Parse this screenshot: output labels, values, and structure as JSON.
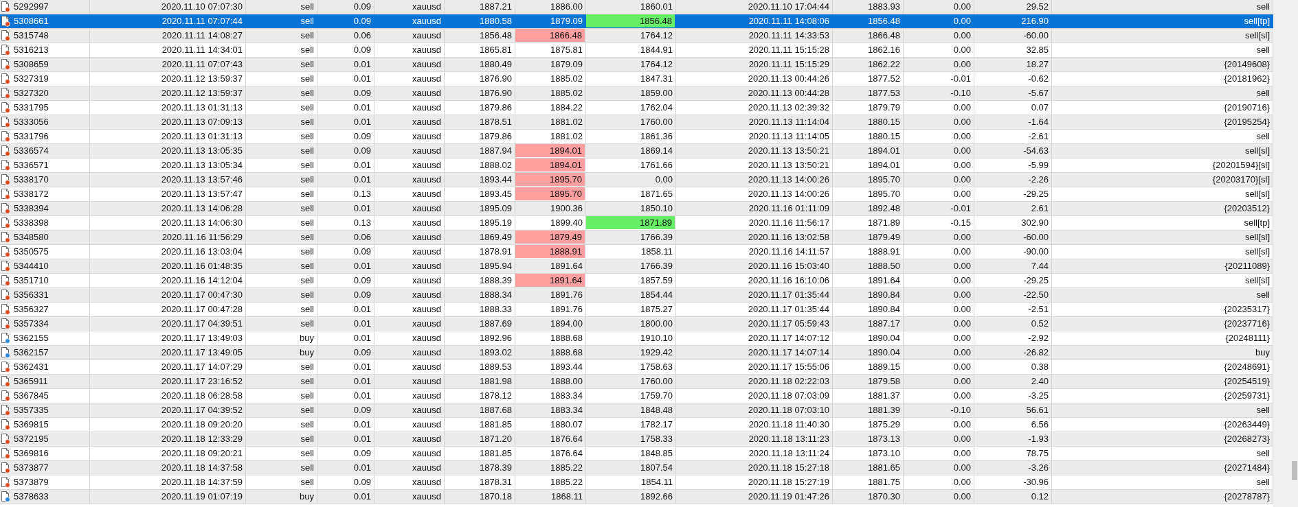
{
  "table": {
    "rows": [
      {
        "kind": "sell",
        "selected": false,
        "column_7_marked": false,
        "column_8_marked": false,
        "cells": [
          "5292997",
          "2020.11.10 07:07:30",
          "sell",
          "0.09",
          "xauusd",
          "1887.21",
          "1886.00",
          "1860.01",
          "2020.11.10 17:04:44",
          "1883.93",
          "0.00",
          "29.52",
          "sell"
        ]
      },
      {
        "kind": "sell",
        "selected": true,
        "column_7_marked": false,
        "column_8_marked": true,
        "cells": [
          "5308661",
          "2020.11.11 07:07:44",
          "sell",
          "0.09",
          "xauusd",
          "1880.58",
          "1879.09",
          "1856.48",
          "2020.11.11 14:08:06",
          "1856.48",
          "0.00",
          "216.90",
          "sell[tp]"
        ]
      },
      {
        "kind": "sell",
        "selected": false,
        "column_7_marked": true,
        "column_8_marked": false,
        "cells": [
          "5315748",
          "2020.11.11 14:08:27",
          "sell",
          "0.06",
          "xauusd",
          "1856.48",
          "1866.48",
          "1764.12",
          "2020.11.11 14:33:53",
          "1866.48",
          "0.00",
          "-60.00",
          "sell[sl]"
        ]
      },
      {
        "kind": "sell",
        "selected": false,
        "column_7_marked": false,
        "column_8_marked": false,
        "cells": [
          "5316213",
          "2020.11.11 14:34:01",
          "sell",
          "0.09",
          "xauusd",
          "1865.81",
          "1875.81",
          "1844.91",
          "2020.11.11 15:15:28",
          "1862.16",
          "0.00",
          "32.85",
          "sell"
        ]
      },
      {
        "kind": "sell",
        "selected": false,
        "column_7_marked": false,
        "column_8_marked": false,
        "cells": [
          "5308659",
          "2020.11.11 07:07:43",
          "sell",
          "0.01",
          "xauusd",
          "1880.49",
          "1879.09",
          "1764.12",
          "2020.11.11 15:15:29",
          "1862.22",
          "0.00",
          "18.27",
          "{20149608}"
        ]
      },
      {
        "kind": "sell",
        "selected": false,
        "column_7_marked": false,
        "column_8_marked": false,
        "cells": [
          "5327319",
          "2020.11.12 13:59:37",
          "sell",
          "0.01",
          "xauusd",
          "1876.90",
          "1885.02",
          "1847.31",
          "2020.11.13 00:44:26",
          "1877.52",
          "-0.01",
          "-0.62",
          "{20181962}"
        ]
      },
      {
        "kind": "sell",
        "selected": false,
        "column_7_marked": false,
        "column_8_marked": false,
        "cells": [
          "5327320",
          "2020.11.12 13:59:37",
          "sell",
          "0.09",
          "xauusd",
          "1876.90",
          "1885.02",
          "1859.00",
          "2020.11.13 00:44:28",
          "1877.53",
          "-0.10",
          "-5.67",
          "sell"
        ]
      },
      {
        "kind": "sell",
        "selected": false,
        "column_7_marked": false,
        "column_8_marked": false,
        "cells": [
          "5331795",
          "2020.11.13 01:31:13",
          "sell",
          "0.01",
          "xauusd",
          "1879.86",
          "1884.22",
          "1762.04",
          "2020.11.13 02:39:32",
          "1879.79",
          "0.00",
          "0.07",
          "{20190716}"
        ]
      },
      {
        "kind": "sell",
        "selected": false,
        "column_7_marked": false,
        "column_8_marked": false,
        "cells": [
          "5333056",
          "2020.11.13 07:09:13",
          "sell",
          "0.01",
          "xauusd",
          "1878.51",
          "1881.02",
          "1760.00",
          "2020.11.13 11:14:04",
          "1880.15",
          "0.00",
          "-1.64",
          "{20195254}"
        ]
      },
      {
        "kind": "sell",
        "selected": false,
        "column_7_marked": false,
        "column_8_marked": false,
        "cells": [
          "5331796",
          "2020.11.13 01:31:13",
          "sell",
          "0.09",
          "xauusd",
          "1879.86",
          "1881.02",
          "1861.36",
          "2020.11.13 11:14:05",
          "1880.15",
          "0.00",
          "-2.61",
          "sell"
        ]
      },
      {
        "kind": "sell",
        "selected": false,
        "column_7_marked": true,
        "column_8_marked": false,
        "cells": [
          "5336574",
          "2020.11.13 13:05:35",
          "sell",
          "0.09",
          "xauusd",
          "1887.94",
          "1894.01",
          "1869.14",
          "2020.11.13 13:50:21",
          "1894.01",
          "0.00",
          "-54.63",
          "sell[sl]"
        ]
      },
      {
        "kind": "sell",
        "selected": false,
        "column_7_marked": true,
        "column_8_marked": false,
        "cells": [
          "5336571",
          "2020.11.13 13:05:34",
          "sell",
          "0.01",
          "xauusd",
          "1888.02",
          "1894.01",
          "1761.66",
          "2020.11.13 13:50:21",
          "1894.01",
          "0.00",
          "-5.99",
          "{20201594}[sl]"
        ]
      },
      {
        "kind": "sell",
        "selected": false,
        "column_7_marked": true,
        "column_8_marked": false,
        "cells": [
          "5338170",
          "2020.11.13 13:57:46",
          "sell",
          "0.01",
          "xauusd",
          "1893.44",
          "1895.70",
          "0.00",
          "2020.11.13 14:00:26",
          "1895.70",
          "0.00",
          "-2.26",
          "{20203170}[sl]"
        ]
      },
      {
        "kind": "sell",
        "selected": false,
        "column_7_marked": true,
        "column_8_marked": false,
        "cells": [
          "5338172",
          "2020.11.13 13:57:47",
          "sell",
          "0.13",
          "xauusd",
          "1893.45",
          "1895.70",
          "1871.65",
          "2020.11.13 14:00:26",
          "1895.70",
          "0.00",
          "-29.25",
          "sell[sl]"
        ]
      },
      {
        "kind": "sell",
        "selected": false,
        "column_7_marked": false,
        "column_8_marked": false,
        "cells": [
          "5338394",
          "2020.11.13 14:06:28",
          "sell",
          "0.01",
          "xauusd",
          "1895.09",
          "1900.36",
          "1850.10",
          "2020.11.16 01:11:09",
          "1892.48",
          "-0.01",
          "2.61",
          "{20203512}"
        ]
      },
      {
        "kind": "sell",
        "selected": false,
        "column_7_marked": false,
        "column_8_marked": true,
        "cells": [
          "5338398",
          "2020.11.13 14:06:30",
          "sell",
          "0.13",
          "xauusd",
          "1895.19",
          "1899.40",
          "1871.89",
          "2020.11.16 11:56:17",
          "1871.89",
          "-0.15",
          "302.90",
          "sell[tp]"
        ]
      },
      {
        "kind": "sell",
        "selected": false,
        "column_7_marked": true,
        "column_8_marked": false,
        "cells": [
          "5348580",
          "2020.11.16 11:56:29",
          "sell",
          "0.06",
          "xauusd",
          "1869.49",
          "1879.49",
          "1766.39",
          "2020.11.16 13:02:58",
          "1879.49",
          "0.00",
          "-60.00",
          "sell[sl]"
        ]
      },
      {
        "kind": "sell",
        "selected": false,
        "column_7_marked": true,
        "column_8_marked": false,
        "cells": [
          "5350575",
          "2020.11.16 13:03:04",
          "sell",
          "0.09",
          "xauusd",
          "1878.91",
          "1888.91",
          "1858.11",
          "2020.11.16 14:11:57",
          "1888.91",
          "0.00",
          "-90.00",
          "sell[sl]"
        ]
      },
      {
        "kind": "sell",
        "selected": false,
        "column_7_marked": false,
        "column_8_marked": false,
        "cells": [
          "5344410",
          "2020.11.16 01:48:35",
          "sell",
          "0.01",
          "xauusd",
          "1895.94",
          "1891.64",
          "1766.39",
          "2020.11.16 15:03:40",
          "1888.50",
          "0.00",
          "7.44",
          "{20211089}"
        ]
      },
      {
        "kind": "sell",
        "selected": false,
        "column_7_marked": true,
        "column_8_marked": false,
        "cells": [
          "5351710",
          "2020.11.16 14:12:04",
          "sell",
          "0.09",
          "xauusd",
          "1888.39",
          "1891.64",
          "1857.59",
          "2020.11.16 16:10:06",
          "1891.64",
          "0.00",
          "-29.25",
          "sell[sl]"
        ]
      },
      {
        "kind": "sell",
        "selected": false,
        "column_7_marked": false,
        "column_8_marked": false,
        "cells": [
          "5356331",
          "2020.11.17 00:47:30",
          "sell",
          "0.09",
          "xauusd",
          "1888.34",
          "1891.76",
          "1854.44",
          "2020.11.17 01:35:44",
          "1890.84",
          "0.00",
          "-22.50",
          "sell"
        ]
      },
      {
        "kind": "sell",
        "selected": false,
        "column_7_marked": false,
        "column_8_marked": false,
        "cells": [
          "5356327",
          "2020.11.17 00:47:28",
          "sell",
          "0.01",
          "xauusd",
          "1888.33",
          "1891.76",
          "1875.27",
          "2020.11.17 01:35:44",
          "1890.84",
          "0.00",
          "-2.51",
          "{20235317}"
        ]
      },
      {
        "kind": "sell",
        "selected": false,
        "column_7_marked": false,
        "column_8_marked": false,
        "cells": [
          "5357334",
          "2020.11.17 04:39:51",
          "sell",
          "0.01",
          "xauusd",
          "1887.69",
          "1894.00",
          "1800.00",
          "2020.11.17 05:59:43",
          "1887.17",
          "0.00",
          "0.52",
          "{20237716}"
        ]
      },
      {
        "kind": "buy",
        "selected": false,
        "column_7_marked": false,
        "column_8_marked": false,
        "cells": [
          "5362155",
          "2020.11.17 13:49:03",
          "buy",
          "0.01",
          "xauusd",
          "1892.96",
          "1888.68",
          "1910.10",
          "2020.11.17 14:07:12",
          "1890.04",
          "0.00",
          "-2.92",
          "{20248111}"
        ]
      },
      {
        "kind": "buy",
        "selected": false,
        "column_7_marked": false,
        "column_8_marked": false,
        "cells": [
          "5362157",
          "2020.11.17 13:49:05",
          "buy",
          "0.09",
          "xauusd",
          "1893.02",
          "1888.68",
          "1929.42",
          "2020.11.17 14:07:14",
          "1890.04",
          "0.00",
          "-26.82",
          "buy"
        ]
      },
      {
        "kind": "sell",
        "selected": false,
        "column_7_marked": false,
        "column_8_marked": false,
        "cells": [
          "5362431",
          "2020.11.17 14:07:29",
          "sell",
          "0.01",
          "xauusd",
          "1889.53",
          "1893.44",
          "1758.63",
          "2020.11.17 15:55:06",
          "1889.15",
          "0.00",
          "0.38",
          "{20248691}"
        ]
      },
      {
        "kind": "sell",
        "selected": false,
        "column_7_marked": false,
        "column_8_marked": false,
        "cells": [
          "5365911",
          "2020.11.17 23:16:52",
          "sell",
          "0.01",
          "xauusd",
          "1881.98",
          "1888.00",
          "1760.00",
          "2020.11.18 02:22:03",
          "1879.58",
          "0.00",
          "2.40",
          "{20254519}"
        ]
      },
      {
        "kind": "sell",
        "selected": false,
        "column_7_marked": false,
        "column_8_marked": false,
        "cells": [
          "5367845",
          "2020.11.18 06:28:58",
          "sell",
          "0.01",
          "xauusd",
          "1878.12",
          "1883.34",
          "1759.70",
          "2020.11.18 07:03:09",
          "1881.37",
          "0.00",
          "-3.25",
          "{20259731}"
        ]
      },
      {
        "kind": "sell",
        "selected": false,
        "column_7_marked": false,
        "column_8_marked": false,
        "cells": [
          "5357335",
          "2020.11.17 04:39:52",
          "sell",
          "0.09",
          "xauusd",
          "1887.68",
          "1883.34",
          "1848.48",
          "2020.11.18 07:03:10",
          "1881.39",
          "-0.10",
          "56.61",
          "sell"
        ]
      },
      {
        "kind": "sell",
        "selected": false,
        "column_7_marked": false,
        "column_8_marked": false,
        "cells": [
          "5369815",
          "2020.11.18 09:20:20",
          "sell",
          "0.01",
          "xauusd",
          "1881.85",
          "1880.07",
          "1782.17",
          "2020.11.18 11:40:30",
          "1875.29",
          "0.00",
          "6.56",
          "{20263449}"
        ]
      },
      {
        "kind": "sell",
        "selected": false,
        "column_7_marked": false,
        "column_8_marked": false,
        "cells": [
          "5372195",
          "2020.11.18 12:33:29",
          "sell",
          "0.01",
          "xauusd",
          "1871.20",
          "1876.64",
          "1758.33",
          "2020.11.18 13:11:23",
          "1873.13",
          "0.00",
          "-1.93",
          "{20268273}"
        ]
      },
      {
        "kind": "sell",
        "selected": false,
        "column_7_marked": false,
        "column_8_marked": false,
        "cells": [
          "5369816",
          "2020.11.18 09:20:21",
          "sell",
          "0.09",
          "xauusd",
          "1881.85",
          "1876.64",
          "1848.85",
          "2020.11.18 13:11:24",
          "1873.10",
          "0.00",
          "78.75",
          "sell"
        ]
      },
      {
        "kind": "sell",
        "selected": false,
        "column_7_marked": false,
        "column_8_marked": false,
        "cells": [
          "5373877",
          "2020.11.18 14:37:58",
          "sell",
          "0.01",
          "xauusd",
          "1878.39",
          "1885.22",
          "1807.54",
          "2020.11.18 15:27:18",
          "1881.65",
          "0.00",
          "-3.26",
          "{20271484}"
        ]
      },
      {
        "kind": "sell",
        "selected": false,
        "column_7_marked": false,
        "column_8_marked": false,
        "cells": [
          "5373879",
          "2020.11.18 14:37:59",
          "sell",
          "0.09",
          "xauusd",
          "1878.31",
          "1885.22",
          "1854.11",
          "2020.11.18 15:27:19",
          "1881.75",
          "0.00",
          "-30.96",
          "sell"
        ]
      },
      {
        "kind": "buy",
        "selected": false,
        "column_7_marked": false,
        "column_8_marked": false,
        "cells": [
          "5378633",
          "2020.11.19 01:07:19",
          "buy",
          "0.01",
          "xauusd",
          "1870.18",
          "1868.11",
          "1892.66",
          "2020.11.19 01:47:26",
          "1870.30",
          "0.00",
          "0.12",
          "{20278787}"
        ]
      }
    ]
  }
}
